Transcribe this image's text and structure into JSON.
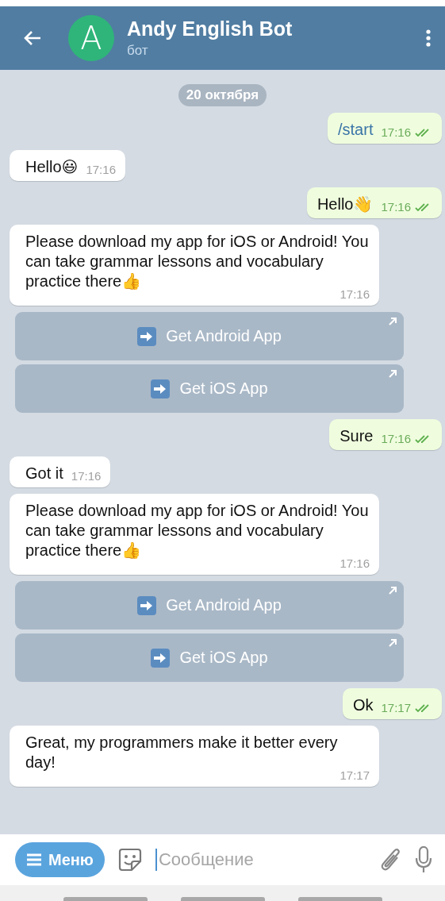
{
  "header": {
    "title": "Andy English Bot",
    "subtitle": "бот",
    "avatar_letter": "A"
  },
  "date_chip": "20 октября",
  "messages": [
    {
      "kind": "out",
      "text": "/start",
      "time": "17:16",
      "read": true,
      "command": true
    },
    {
      "kind": "in",
      "text": "Hello😃",
      "time": "17:16"
    },
    {
      "kind": "out",
      "text": "Hello👋",
      "time": "17:16",
      "read": true
    },
    {
      "kind": "in",
      "text": "Please download my app for iOS or Android! You can take grammar lessons and vocabulary practice there👍",
      "time": "17:16"
    },
    {
      "kind": "buttons",
      "buttons": [
        "Get Android App",
        "Get iOS App"
      ]
    },
    {
      "kind": "out",
      "text": "Sure",
      "time": "17:16",
      "read": true
    },
    {
      "kind": "in",
      "text": "Got it",
      "time": "17:16"
    },
    {
      "kind": "in",
      "text": "Please download my app for iOS or Android! You can take grammar lessons and vocabulary practice there👍",
      "time": "17:16"
    },
    {
      "kind": "buttons",
      "buttons": [
        "Get Android App",
        "Get iOS App"
      ]
    },
    {
      "kind": "out",
      "text": "Ok",
      "time": "17:17",
      "read": true
    },
    {
      "kind": "in",
      "text": "Great, my programmers make it better every day!",
      "time": "17:17"
    }
  ],
  "composer": {
    "menu_label": "Меню",
    "placeholder": "Сообщение"
  }
}
